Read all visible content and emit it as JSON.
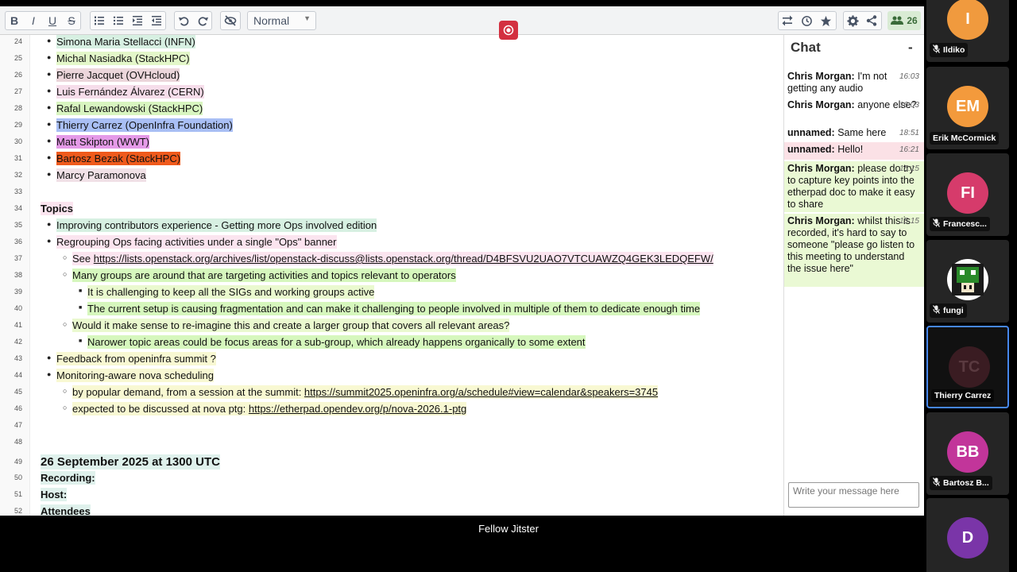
{
  "toolbar": {
    "style_select": "Normal",
    "user_count": "26"
  },
  "editor": {
    "lines": [
      {
        "n": "24",
        "text": "Simona Maria Stellacci (INFN)",
        "indent": 1,
        "bg": "#d7f0e2"
      },
      {
        "n": "25",
        "text": "Michal Nasiadka (StackHPC)",
        "indent": 1,
        "bg": "#e3f7c9"
      },
      {
        "n": "26",
        "text": "Pierre Jacquet (OVHcloud)",
        "indent": 1,
        "bg": "#ecd6db"
      },
      {
        "n": "27",
        "text": "Luis Fernández Álvarez (CERN)",
        "indent": 1,
        "bg": "#f6ddea"
      },
      {
        "n": "28",
        "text": "Rafal Lewandowski (StackHPC)",
        "indent": 1,
        "bg": "#d8f5c0"
      },
      {
        "n": "29",
        "text": "Thierry Carrez (OpenInfra Foundation)",
        "indent": 1,
        "bg": "#a9bff5"
      },
      {
        "n": "30",
        "text": "Matt Skipton (WWT)",
        "indent": 1,
        "bg": "#e59ae8"
      },
      {
        "n": "31",
        "text": "Bartosz Bezak (StackHPC)",
        "indent": 1,
        "bg": "#ef5a1c"
      },
      {
        "n": "32",
        "text": "Marcy Paramonova",
        "indent": 1,
        "bg": "#f1e1e7"
      },
      {
        "n": "33",
        "text": "",
        "indent": 0,
        "bg": ""
      },
      {
        "n": "34",
        "text": "Topics",
        "indent": 0,
        "bg": "#fbe4ef",
        "bold": true
      },
      {
        "n": "35",
        "text": "Improving contributors experience - Getting more Ops involved edition",
        "indent": 1,
        "bg": "#d7f0e2"
      },
      {
        "n": "36",
        "text": "Regrouping Ops facing activities under a single \"Ops\" banner",
        "indent": 1,
        "bg": "#fbe4ef"
      },
      {
        "n": "37",
        "text_prefix": "See ",
        "link": "https://lists.openstack.org/archives/list/openstack-discuss@lists.openstack.org/thread/D4BFSVU2UAO7VTCUAWZQ4GEK3LEDQEFW/",
        "indent": 2,
        "bg": "#fbe4ef"
      },
      {
        "n": "38",
        "text": "Many groups are around that are targeting activities and topics relevant to operators",
        "indent": 2,
        "bg": "#d6f7bd"
      },
      {
        "n": "39",
        "text": "It is challenging to keep all the SIGs and working groups active",
        "indent": 3,
        "bg": "#eaf9cf"
      },
      {
        "n": "40",
        "text": "The current setup is causing fragmentation and can make it challenging to people involved in multiple of them to dedicate enough time",
        "indent": 3,
        "bg": "#d6f7bd"
      },
      {
        "n": "41",
        "text": "Would it make sense to re-imagine this and create a larger group that covers all relevant areas?",
        "indent": 2,
        "bg": "#eaf9cf"
      },
      {
        "n": "42",
        "text": "Narower topic areas could be focus areas for a sub-group, which already happens organically to some extent",
        "indent": 3,
        "bg": "#d6f7bd"
      },
      {
        "n": "43",
        "text": "Feedback from openinfra summit ?",
        "indent": 1,
        "bg": "#f8f8d2"
      },
      {
        "n": "44",
        "text": "Monitoring-aware nova scheduling",
        "indent": 1,
        "bg": "#f8f8d2"
      },
      {
        "n": "45",
        "text_prefix": "by popular demand, from a session at the summit: ",
        "link": "https://summit2025.openinfra.org/a/schedule#view=calendar&speakers=3745",
        "indent": 2,
        "bg": "#f8f8d2"
      },
      {
        "n": "46",
        "text_prefix": "expected to be discussed at nova ptg: ",
        "link": "https://etherpad.opendev.org/p/nova-2026.1-ptg",
        "indent": 2,
        "bg": "#f8f8d2"
      },
      {
        "n": "47",
        "text": "",
        "indent": 0,
        "bg": ""
      },
      {
        "n": "48",
        "text": "",
        "indent": 0,
        "bg": ""
      },
      {
        "n": "49",
        "text": "26 September 2025 at 1300 UTC",
        "indent": 0,
        "bg": "#dff1ec",
        "heading": true
      },
      {
        "n": "50",
        "text": "Recording:",
        "indent": 0,
        "bg": "#dff1ec",
        "bold_label": true
      },
      {
        "n": "51",
        "text": "Host:",
        "indent": 0,
        "bg": "#dff1ec",
        "bold_label": true
      },
      {
        "n": "52",
        "text": "Attendees",
        "indent": 0,
        "bg": "#dff1ec",
        "bold": true
      }
    ]
  },
  "chat": {
    "title": "Chat",
    "minimize": "-",
    "messages": [
      {
        "who": "Chris Morgan:",
        "text": " I'm not getting any audio",
        "time": "16:03",
        "bg": "#ffffff"
      },
      {
        "who": "Chris Morgan:",
        "text": " anyone else?",
        "time": "16:03",
        "bg": "#ffffff"
      },
      {
        "who": "unnamed:",
        "text": " Same here",
        "time": "18:51",
        "bg": "#ffffff"
      },
      {
        "who": "unnamed:",
        "text": " Hello!",
        "time": "16:21",
        "bg": "#fbe1e6"
      },
      {
        "who": "Chris Morgan:",
        "text": " please do try to capture key points into the etherpad doc to make it easy to share",
        "time": "15:15",
        "bg": "#eaf9d4"
      },
      {
        "who": "Chris Morgan:",
        "text": " whilst this is recorded, it's hard to say to someone \"please go listen to this meeting to understand the issue here\"",
        "time": "15:15",
        "bg": "#eaf9d4"
      }
    ],
    "placeholder": "Write your message here"
  },
  "stage": {
    "label": "Fellow Jitster"
  },
  "participants": [
    {
      "initials": "I",
      "name": "Ildiko",
      "color": "#f09a3e",
      "muted": true
    },
    {
      "initials": "EM",
      "name": "Erik McCormick",
      "color": "#f39a3c",
      "muted": false
    },
    {
      "initials": "FI",
      "name": "Francesc...",
      "color": "#d63b6b",
      "muted": true
    },
    {
      "initials": "",
      "name": "fungi",
      "color": "#ffffff",
      "muted": true
    },
    {
      "initials": "TC",
      "name": "Thierry Carrez",
      "color": "#3a1c22",
      "muted": false,
      "active": true
    },
    {
      "initials": "BB",
      "name": "Bartosz B...",
      "color": "#c2359a",
      "muted": true
    },
    {
      "initials": "D",
      "name": "",
      "color": "#7a35a8",
      "muted": false
    }
  ]
}
